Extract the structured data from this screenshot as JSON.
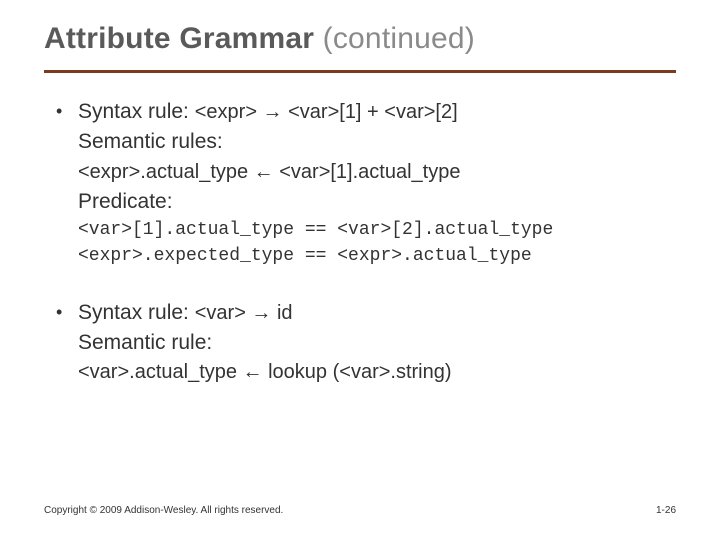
{
  "title_main": "Attribute Grammar ",
  "title_sub": "(continued)",
  "bullets": [
    {
      "syntax_label": "Syntax rule: ",
      "syntax_code": "<expr> → <var>[1] + <var>[2]",
      "sem_label": "Semantic rules:",
      "sem_code": "<expr>.actual_type ← <var>[1].actual_type",
      "pred_label": "Predicate:",
      "pred_code_1": "<var>[1].actual_type == <var>[2].actual_type",
      "pred_code_2": "<expr>.expected_type == <expr>.actual_type"
    },
    {
      "syntax_label": "Syntax rule: ",
      "syntax_code": "<var> → id",
      "sem_label": "Semantic rule:",
      "sem_code": "<var>.actual_type ← lookup (<var>.string)"
    }
  ],
  "footer": {
    "copyright": "Copyright © 2009 Addison-Wesley. All rights reserved.",
    "page": "1-26"
  }
}
